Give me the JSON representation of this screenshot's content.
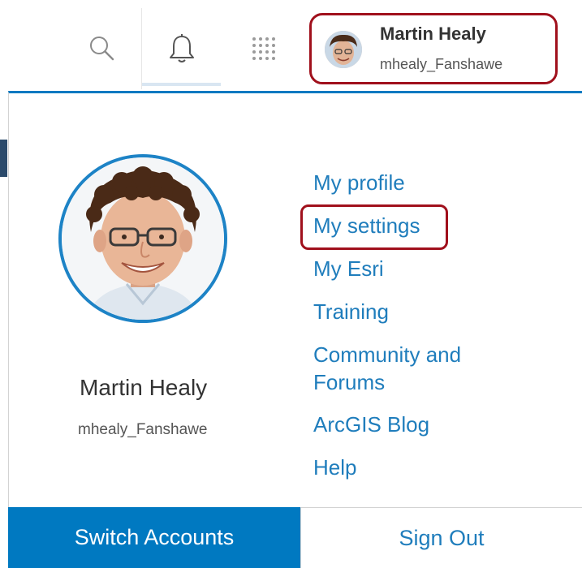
{
  "header": {
    "search_icon": "search-icon",
    "notifications_icon": "bell-icon",
    "apps_icon": "grid-icon",
    "user": {
      "name": "Martin Healy",
      "username": "mhealy_Fanshawe"
    }
  },
  "profile": {
    "name": "Martin Healy",
    "username": "mhealy_Fanshawe"
  },
  "menu": {
    "items": [
      {
        "label": "My profile"
      },
      {
        "label": "My settings",
        "highlighted": true
      },
      {
        "label": "My Esri"
      },
      {
        "label": "Training"
      },
      {
        "label": "Community and Forums"
      },
      {
        "label": "ArcGIS Blog"
      },
      {
        "label": "Help"
      }
    ]
  },
  "footer": {
    "switch_label": "Switch Accounts",
    "signout_label": "Sign Out"
  },
  "colors": {
    "accent": "#0079c1",
    "link": "#1f7dbc",
    "highlight": "#a0101c"
  }
}
